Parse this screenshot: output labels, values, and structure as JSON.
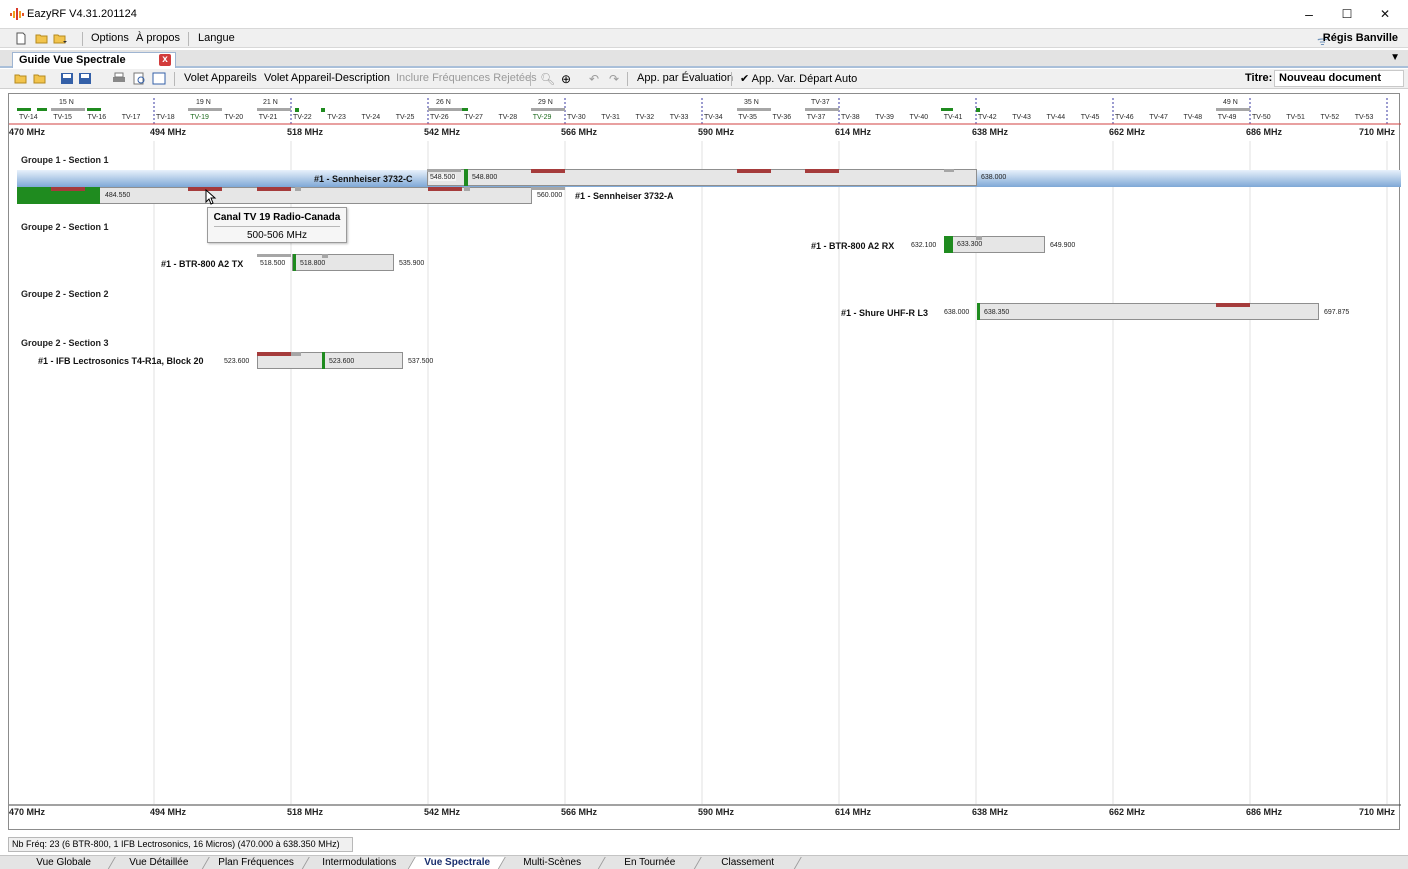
{
  "window": {
    "title": "EazyRF V4.31.201124",
    "minimize": "–",
    "maximize": "☐",
    "close": "✕"
  },
  "menu": {
    "items": [
      "Options",
      "À propos",
      "Langue"
    ],
    "user": "Régis Banville"
  },
  "doc_tab": {
    "label": "Guide Vue Spectrale",
    "close": "x"
  },
  "toolbar": {
    "volet_appareils": "Volet Appareils",
    "volet_description": "Volet Appareil-Description",
    "inclure_rejetees": "Inclure Fréquences Rejetées",
    "app_evaluation": "App. par Évaluation",
    "app_var_depart": "✔ App. Var. Départ Auto",
    "titre_label": "Titre:",
    "titre_value": "Nouveau document"
  },
  "axis": {
    "freq_labels": [
      "470 MHz",
      "494 MHz",
      "518 MHz",
      "542 MHz",
      "566 MHz",
      "590 MHz",
      "614 MHz",
      "638 MHz",
      "662 MHz",
      "686 MHz",
      "710 MHz"
    ],
    "tv_channels": [
      "TV-14",
      "TV-15",
      "TV-16",
      "TV-17",
      "TV-18",
      "TV-19",
      "TV-20",
      "TV-21",
      "TV-22",
      "TV-23",
      "TV-24",
      "TV-25",
      "TV-26",
      "TV-27",
      "TV-28",
      "TV-29",
      "TV-30",
      "TV-31",
      "TV-32",
      "TV-33",
      "TV-34",
      "TV-35",
      "TV-36",
      "TV-37",
      "TV-38",
      "TV-39",
      "TV-40",
      "TV-41",
      "TV-42",
      "TV-43",
      "TV-44",
      "TV-45",
      "TV-46",
      "TV-47",
      "TV-48",
      "TV-49",
      "TV-50",
      "TV-51",
      "TV-52",
      "TV-53"
    ],
    "top_channel_labels": [
      "15 N",
      "19 N",
      "21 N",
      "26 N",
      "29 N",
      "35 N",
      "TV-37",
      "49 N"
    ]
  },
  "groups": [
    {
      "label": "Groupe 1 - Section 1"
    },
    {
      "label": "Groupe 2 - Section 1"
    },
    {
      "label": "Groupe 2 - Section 2"
    },
    {
      "label": "Groupe 2 - Section 3"
    }
  ],
  "devices": {
    "sennheiser_c": {
      "name": "#1 - Sennheiser 3732-C",
      "start": "548.500",
      "freq": "548.800",
      "end": "638.000"
    },
    "sennheiser_a": {
      "name": "#1 - Sennheiser 3732-A",
      "freq": "484.550",
      "end": "560.000"
    },
    "btr_rx": {
      "name": "#1 - BTR-800 A2 RX",
      "start": "632.100",
      "freq": "633.300",
      "end": "649.900"
    },
    "btr_tx": {
      "name": "#1 - BTR-800 A2 TX",
      "start": "518.500",
      "freq": "518.800",
      "end": "535.900"
    },
    "shure": {
      "name": "#1 - Shure UHF-R L3",
      "start": "638.000",
      "freq": "638.350",
      "end": "697.875"
    },
    "ifb": {
      "name": "#1 - IFB Lectrosonics T4-R1a, Block 20",
      "start": "523.600",
      "freq": "523.600",
      "end": "537.500"
    }
  },
  "tooltip": {
    "title": "Canal TV 19 Radio-Canada",
    "range": "500-506 MHz"
  },
  "status": "Nb Fréq: 23 (6 BTR-800, 1 IFB Lectrosonics, 16 Micros) (470.000 à 638.350 MHz)",
  "bottom_tabs": [
    "Vue Globale",
    "Vue Détaillée",
    "Plan Fréquences",
    "Intermodulations",
    "Vue Spectrale",
    "Multi-Scènes",
    "En Tournée",
    "Classement"
  ],
  "active_tab": "Vue Spectrale",
  "colors": {
    "accent_blue": "#1a2f6e",
    "interference_red": "#a53b3b",
    "carrier_green": "#1f8b1f",
    "band_fill": "#e6e6e6"
  }
}
